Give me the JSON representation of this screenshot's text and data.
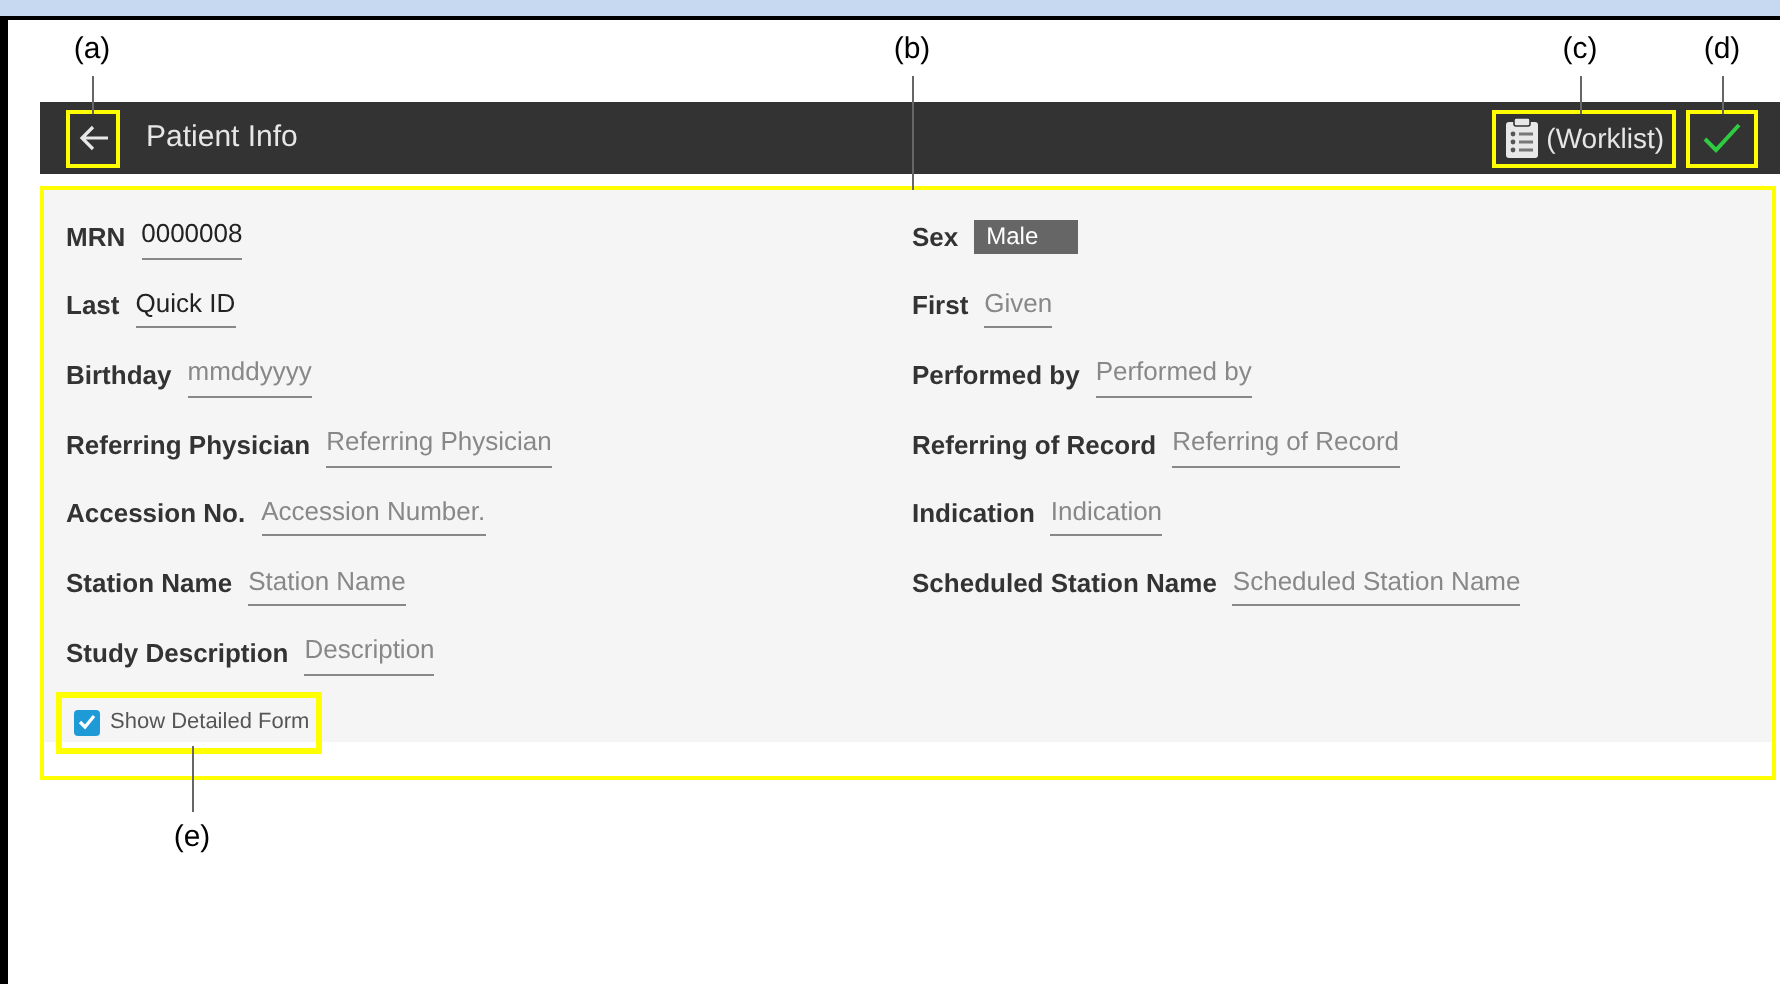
{
  "callouts": [
    {
      "label": "(a)"
    },
    {
      "label": "(b)"
    },
    {
      "label": "(c)"
    },
    {
      "label": "(d)"
    },
    {
      "label": "(e)"
    }
  ],
  "app_bar": {
    "title": "Patient Info",
    "back_button": {
      "highlighted": true
    },
    "worklist_button": {
      "label": "(Worklist)",
      "highlighted": true
    },
    "confirm_button": {
      "highlighted": true
    }
  },
  "form": {
    "highlighted": true,
    "left_fields": [
      {
        "label": "MRN",
        "kind": "text",
        "value": "0000008"
      },
      {
        "label": "Last",
        "kind": "text",
        "value": "Quick ID"
      },
      {
        "label": "Birthday",
        "kind": "text",
        "placeholder": "mmddyyyy"
      },
      {
        "label": "Referring Physician",
        "kind": "text",
        "placeholder": "Referring Physician"
      },
      {
        "label": "Accession No.",
        "kind": "text",
        "placeholder": "Accession Number."
      },
      {
        "label": "Station Name",
        "kind": "text",
        "placeholder": "Station Name"
      },
      {
        "label": "Study Description",
        "kind": "text",
        "placeholder": "Description"
      }
    ],
    "right_fields": [
      {
        "label": "Sex",
        "kind": "select",
        "value": "Male"
      },
      {
        "label": "First",
        "kind": "text",
        "placeholder": "Given"
      },
      {
        "label": "Performed by",
        "kind": "text",
        "placeholder": "Performed by"
      },
      {
        "label": "Referring of Record",
        "kind": "text",
        "placeholder": "Referring of Record"
      },
      {
        "label": "Indication",
        "kind": "text",
        "placeholder": "Indication"
      },
      {
        "label": "Scheduled Station Name",
        "kind": "text",
        "placeholder": "Scheduled Station Name"
      }
    ],
    "show_detailed_form": {
      "label": "Show Detailed Form",
      "checked": true,
      "highlighted": true
    }
  }
}
